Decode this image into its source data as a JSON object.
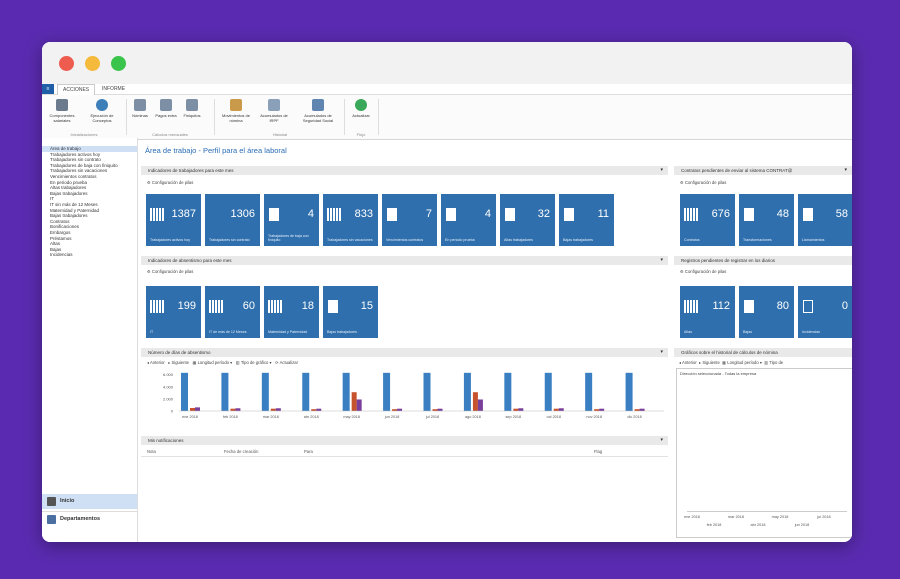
{
  "menubar": {
    "file_label": "≡",
    "tabs": [
      "ACCIONES",
      "INFORME"
    ]
  },
  "ribbon": {
    "buttons": [
      {
        "label": "Componentes salariales",
        "icon": "gears-icon"
      },
      {
        "label": "Ejecución de Conceptos",
        "icon": "globe-icon"
      },
      {
        "label": "Nóminas",
        "icon": "list-icon"
      },
      {
        "label": "Pagos extra",
        "icon": "list-icon"
      },
      {
        "label": "Finiquitos",
        "icon": "list-icon"
      },
      {
        "label": "Movimientos de nómina",
        "icon": "chart-icon"
      },
      {
        "label": "Acumulados de IRPF",
        "icon": "people-icon"
      },
      {
        "label": "Acumulados de Seguridad Social",
        "icon": "people-icon"
      },
      {
        "label": "Actualizar",
        "icon": "refresh-icon"
      }
    ],
    "groups": [
      "Inicializaciones",
      "Cálculos mensuales",
      "Historial",
      "Flujo"
    ]
  },
  "sidebar": {
    "items": [
      "Área de trabajo",
      "Trabajadores activos hoy",
      "Trabajadores sin contrato",
      "Trabajadores de baja con finiquito",
      "Trabajadores sin vacaciones",
      "Vencimientos contratos",
      "En periodo prueba",
      "Altas trabajadores",
      "Bajas trabajadores",
      "IT",
      "IT sin más de 12 Meses",
      "Maternidad y Paternidad",
      "Bajas trabajadores",
      "Contratos",
      "Bonificaciones",
      "Embargos",
      "Préstamos",
      "Altas",
      "Bajas",
      "Incidencias"
    ],
    "bottom": [
      "Inicio",
      "Departamentos"
    ]
  },
  "main": {
    "title": "Área de trabajo - Perfil para el área laboral",
    "section1": {
      "title": "Indicadores de trabajadores para este mes",
      "config": "Configuración de pilas",
      "tiles": [
        {
          "value": "1387",
          "label": "Trabajadores activos hoy",
          "icon": "doc-stack"
        },
        {
          "value": "1306",
          "label": "Trabajadores sin contrato",
          "icon": "none"
        },
        {
          "value": "4",
          "label": "Trabajadores de baja con finiquito",
          "icon": "doc"
        },
        {
          "value": "833",
          "label": "Trabajadores sin vacaciones",
          "icon": "doc-stack"
        },
        {
          "value": "7",
          "label": "Vencimientos contratos",
          "icon": "doc"
        },
        {
          "value": "4",
          "label": "En periodo prueba",
          "icon": "doc"
        },
        {
          "value": "32",
          "label": "Altas trabajadores",
          "icon": "doc"
        },
        {
          "value": "11",
          "label": "Bajas trabajadores",
          "icon": "doc"
        }
      ]
    },
    "section2": {
      "title": "Indicadores de absentismo para este mes",
      "config": "Configuración de pilas",
      "tiles": [
        {
          "value": "199",
          "label": "IT",
          "icon": "doc-stack"
        },
        {
          "value": "60",
          "label": "IT de más de 12 Meses",
          "icon": "doc-stack"
        },
        {
          "value": "18",
          "label": "Maternidad y Paternidad",
          "icon": "doc-stack"
        },
        {
          "value": "15",
          "label": "Bajas trabajadores",
          "icon": "doc"
        }
      ]
    },
    "section3": {
      "title": "Número de días de absentismo",
      "nav": [
        "Anterior",
        "Siguiente",
        "Longitud período",
        "Tipo de gráfico",
        "Actualizar"
      ]
    },
    "section4": {
      "title": "Mis notificaciones",
      "columns": [
        "Nota",
        "Fecha de creación",
        "Para",
        "Flag"
      ]
    },
    "right1": {
      "title": "Contratos pendientes de enviar al sistema CONTRAT@",
      "config": "Configuración de pilas",
      "tiles": [
        {
          "value": "676",
          "label": "Contratos",
          "icon": "doc-stack"
        },
        {
          "value": "48",
          "label": "Transformaciones",
          "icon": "doc"
        },
        {
          "value": "58",
          "label": "Llamamientos",
          "icon": "doc"
        }
      ]
    },
    "right2": {
      "title": "Registros pendientes de registrar en los diarios",
      "config": "Configuración de pilas",
      "tiles": [
        {
          "value": "112",
          "label": "Altas",
          "icon": "doc-stack"
        },
        {
          "value": "80",
          "label": "Bajas",
          "icon": "doc"
        },
        {
          "value": "0",
          "label": "Incidencias",
          "icon": "doc-outline"
        }
      ]
    },
    "right3": {
      "title": "Gráficos sobre el historial de cálculos de nómina",
      "nav": [
        "Anterior",
        "Siguiente",
        "Longitud período",
        "Tipo de"
      ],
      "subtitle": "Dirección seleccionada - Todas la empresa",
      "xticks": [
        "ene 2018",
        "mar 2018",
        "may 2018",
        "jul 2018"
      ],
      "xticks2": [
        "feb 2018",
        "abr 2018",
        "jun 2018"
      ]
    }
  },
  "chart_data": {
    "type": "bar",
    "categories": [
      "ene 2018",
      "feb 2018",
      "mar 2018",
      "abr 2018",
      "may 2018",
      "jun 2018",
      "jul 2018",
      "ago 2018",
      "sep 2018",
      "oct 2018",
      "nov 2018",
      "dic 2018"
    ],
    "series": [
      {
        "values": [
          6300,
          6300,
          6300,
          6300,
          6300,
          6300,
          6300,
          6300,
          6300,
          6300,
          6300,
          6300
        ],
        "color": "#3a7fc2"
      },
      {
        "values": [
          500,
          380,
          380,
          300,
          3100,
          300,
          300,
          3100,
          380,
          380,
          300,
          300
        ],
        "color": "#c7532e"
      },
      {
        "values": [
          600,
          450,
          450,
          380,
          1900,
          380,
          380,
          1900,
          450,
          450,
          380,
          380
        ],
        "color": "#7a3f9a"
      }
    ],
    "yticks": [
      "6.000",
      "4.000",
      "2.000",
      "0"
    ],
    "ylim": [
      0,
      6600
    ]
  }
}
